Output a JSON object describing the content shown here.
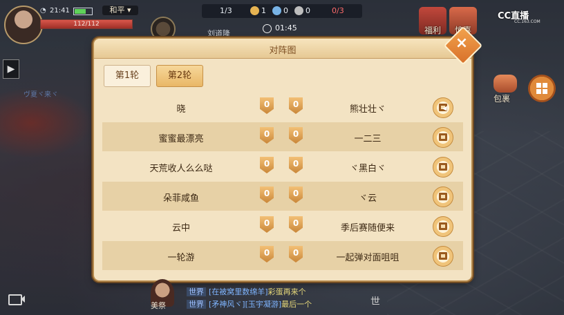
{
  "status": {
    "time": "21:41",
    "mode": "和平",
    "battery_level": 0.6
  },
  "player": {
    "hp": "112/112",
    "name": "刘道隆"
  },
  "match": {
    "team_count": "1/3",
    "coins": [
      "1",
      "0",
      "0"
    ],
    "kills": "0/3",
    "timer": "01:45"
  },
  "right_buttons": [
    {
      "label": "福利"
    },
    {
      "label": "惊喜"
    },
    {
      "label": "包裹"
    }
  ],
  "stream": {
    "logo": "CC直播",
    "url": "CC.163.COM"
  },
  "dialog": {
    "title": "对阵图",
    "close_label": "×",
    "tabs": [
      {
        "label": "第1轮",
        "active": false
      },
      {
        "label": "第2轮",
        "active": true
      }
    ],
    "rows": [
      {
        "left": "晓",
        "left_score": "0",
        "right_score": "0",
        "right": "熊壮壮ヾ"
      },
      {
        "left": "蜜蜜最漂亮",
        "left_score": "0",
        "right_score": "0",
        "right": "一二三"
      },
      {
        "left": "天荒收人么么哒",
        "left_score": "0",
        "right_score": "0",
        "right": "ヾ黑白ヾ"
      },
      {
        "left": "朵菲咸鱼",
        "left_score": "0",
        "right_score": "0",
        "right": "ヾ云"
      },
      {
        "left": "云中",
        "left_score": "0",
        "right_score": "0",
        "right": "季后赛随便来"
      },
      {
        "left": "一轮游",
        "left_score": "0",
        "right_score": "0",
        "right": "一起弹对面咀咀"
      }
    ]
  },
  "chat": {
    "actor": "美祭",
    "lines": [
      {
        "channel": "世界",
        "sender": "[在被窝里数绵羊]",
        "text": "彩蛋再来个"
      },
      {
        "channel": "世界",
        "sender": "[矛神风ヾ][玉宇凝游]",
        "text": "最后一个"
      }
    ],
    "side_char": "世"
  },
  "colors": {
    "accent": "#e9b766",
    "panel": "#f3e3c3",
    "row_alt": "#e7d1a6",
    "close": "#d8712a"
  }
}
